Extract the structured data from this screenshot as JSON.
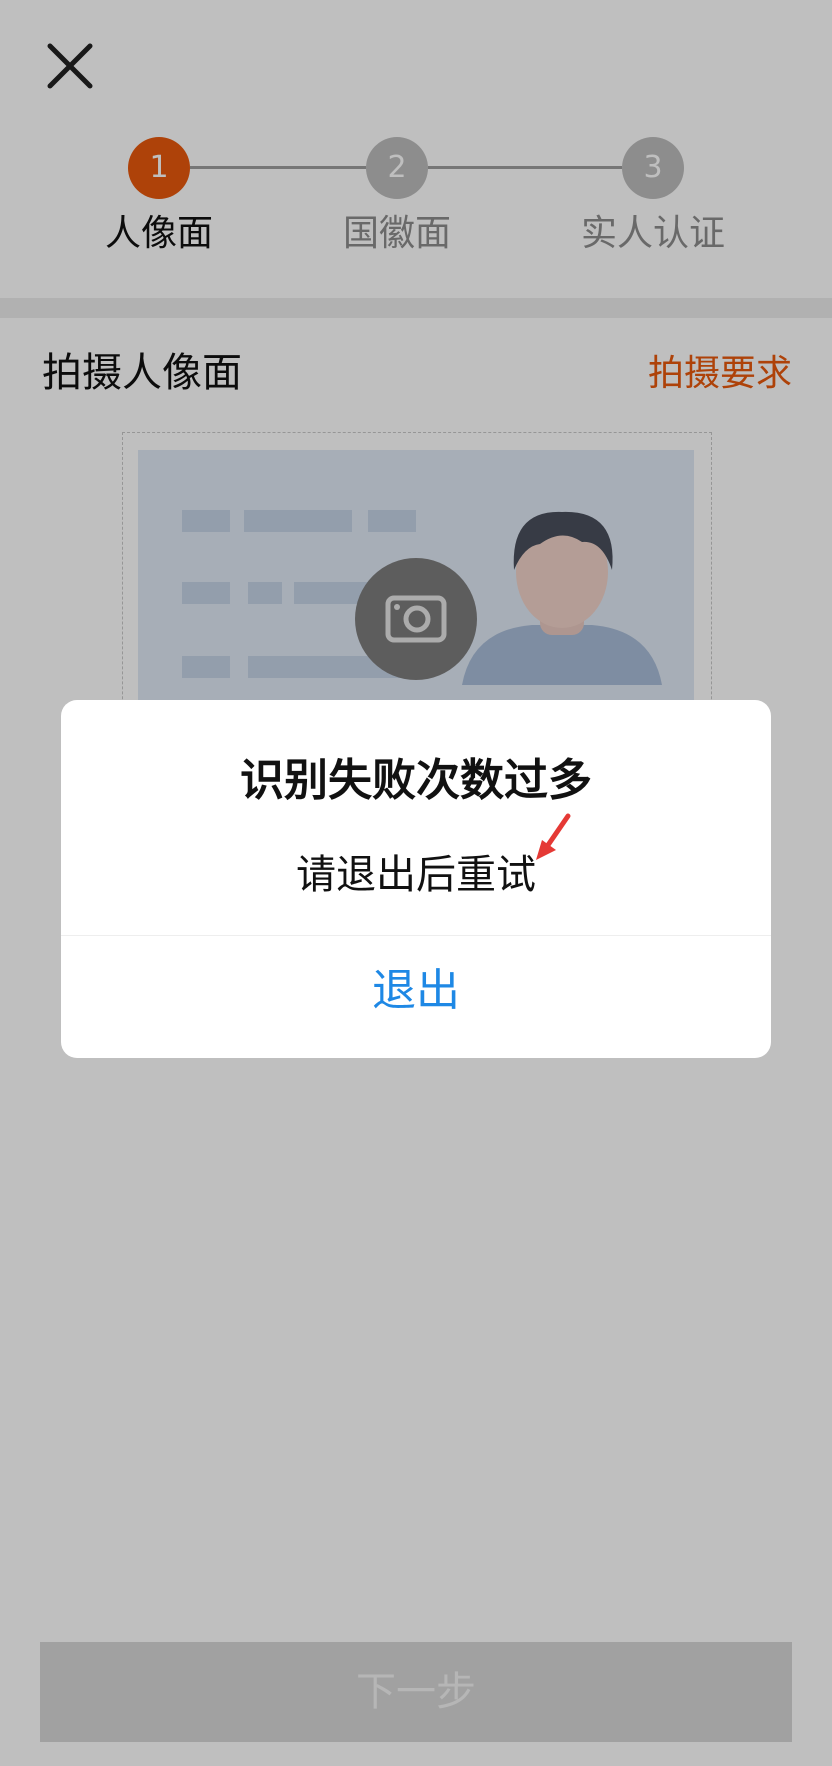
{
  "header": {
    "close_icon": "close-icon"
  },
  "steps": [
    {
      "number": "1",
      "label": "人像面",
      "active": true
    },
    {
      "number": "2",
      "label": "国徽面",
      "active": false
    },
    {
      "number": "3",
      "label": "实人认证",
      "active": false
    }
  ],
  "section": {
    "title": "拍摄人像面",
    "link": "拍摄要求"
  },
  "card": {
    "camera_icon": "camera-icon"
  },
  "footer": {
    "next_label": "下一步"
  },
  "dialog": {
    "title": "识别失败次数过多",
    "message": "请退出后重试",
    "button": "退出"
  },
  "colors": {
    "accent": "#e8590c",
    "link_blue": "#1e88e5",
    "annotation_red": "#e53935"
  }
}
